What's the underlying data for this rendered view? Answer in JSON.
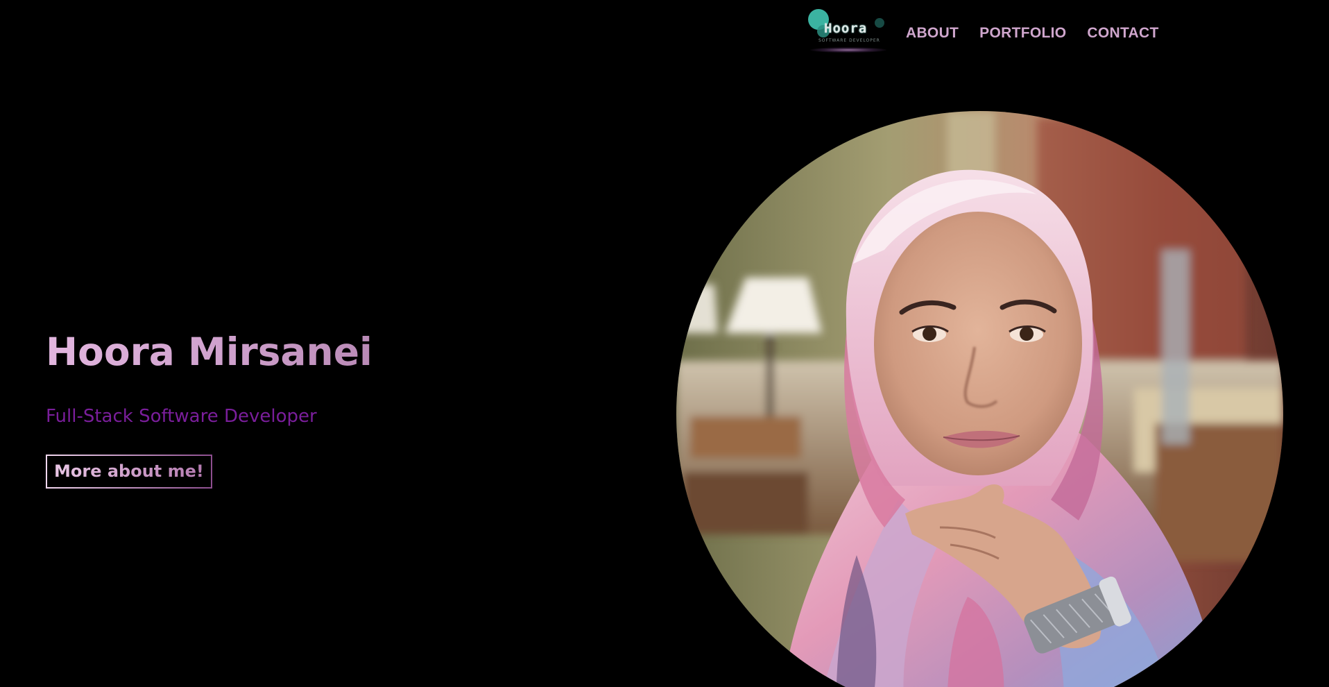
{
  "header": {
    "logo": {
      "wordmark": "Hoora",
      "tagline": "SOFTWARE DEVELOPER"
    },
    "nav": [
      {
        "label": "ABOUT"
      },
      {
        "label": "PORTFOLIO"
      },
      {
        "label": "CONTACT"
      }
    ]
  },
  "hero": {
    "name": "Hoora Mirsanei",
    "role": "Full-Stack Software Developer",
    "cta_label": "More about me!"
  },
  "colors": {
    "background": "#000000",
    "accent_pink": "#d7a9d4",
    "accent_purple": "#7a1e9b",
    "logo_teal": "#3bb3a1"
  },
  "portrait": {
    "icon": "profile-photo"
  }
}
